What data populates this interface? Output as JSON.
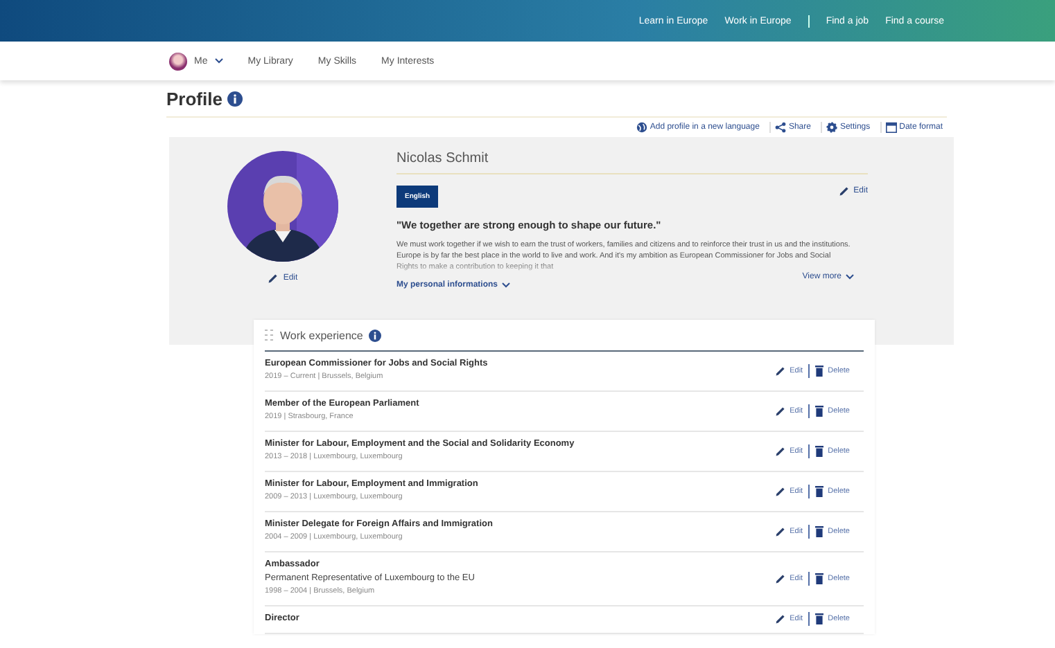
{
  "top_links": [
    "Learn in Europe",
    "Work in Europe",
    "Find a job",
    "Find a course"
  ],
  "nav": {
    "me": "Me",
    "items": [
      "My Library",
      "My Skills",
      "My Interests"
    ]
  },
  "title": "Profile",
  "toolbar": [
    {
      "kind": "language",
      "label": "Add profile in a new language"
    },
    {
      "kind": "share",
      "label": "Share"
    },
    {
      "kind": "settings",
      "label": "Settings"
    },
    {
      "kind": "date",
      "label": "Date format"
    }
  ],
  "profile": {
    "photo_edit": "Edit",
    "name": "Nicolas Schmit",
    "language": "English",
    "edit": "Edit",
    "quote": "\"We together are strong enough to shape our future.\"",
    "bio": "We must work together if we wish to earn the trust of workers, families and citizens and to reinforce their trust in us and the institutions. Europe is by far the best place in the world to live and work. And it's my ambition as European Commissioner for Jobs and Social Rights to make a contribution to keeping it that",
    "view_more": "View more",
    "personal": "My personal informations"
  },
  "work": {
    "title": "Work experience",
    "items": [
      {
        "title": "European Commissioner for Jobs and Social Rights",
        "meta": "2019 – Current | Brussels, Belgium",
        "edit": "Edit",
        "delete": "Delete"
      },
      {
        "title": "Member of the European Parliament",
        "meta": "2019 | Strasbourg, France",
        "edit": "Edit",
        "delete": "Delete"
      },
      {
        "title": "Minister for Labour, Employment and the Social and Solidarity Economy",
        "meta": "2013 – 2018 | Luxembourg, Luxembourg",
        "edit": "Edit",
        "delete": "Delete"
      },
      {
        "title": "Minister for Labour, Employment and Immigration",
        "meta": "2009 – 2013 | Luxembourg, Luxembourg",
        "edit": "Edit",
        "delete": "Delete"
      },
      {
        "title": "Minister Delegate for Foreign Affairs and Immigration",
        "meta": "2004 – 2009 | Luxembourg, Luxembourg",
        "edit": "Edit",
        "delete": "Delete"
      },
      {
        "title": "Ambassador",
        "subtitle": "Permanent Representative of Luxembourg to the EU",
        "meta": "1998 – 2004 | Brussels, Belgium",
        "edit": "Edit",
        "delete": "Delete"
      },
      {
        "title": "Director",
        "edit": "Edit",
        "delete": "Delete"
      }
    ]
  }
}
